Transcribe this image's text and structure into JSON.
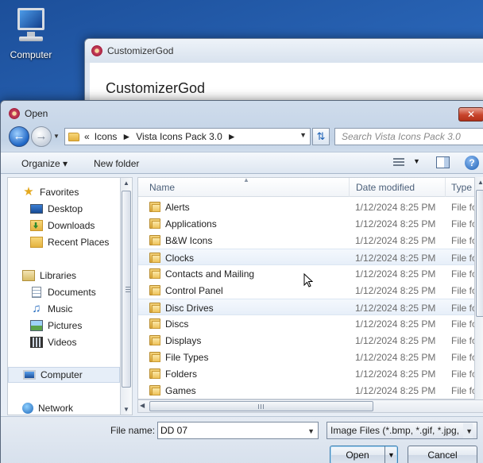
{
  "desktop": {
    "computer_label": "Computer"
  },
  "bg_window": {
    "title": "CustomizerGod",
    "heading": "CustomizerGod"
  },
  "dialog": {
    "title": "Open",
    "close_glyph": "✕",
    "breadcrumb": [
      "Icons",
      "Vista Icons Pack 3.0"
    ],
    "breadcrumb_prefix": "«",
    "search_placeholder": "Search Vista Icons Pack 3.0",
    "toolbar": {
      "organize": "Organize ▾",
      "new_folder": "New folder"
    },
    "nav": {
      "favorites": "Favorites",
      "desktop": "Desktop",
      "downloads": "Downloads",
      "recent_places": "Recent Places",
      "libraries": "Libraries",
      "documents": "Documents",
      "music": "Music",
      "pictures": "Pictures",
      "videos": "Videos",
      "computer": "Computer",
      "network": "Network"
    },
    "columns": {
      "name": "Name",
      "date": "Date modified",
      "type": "Type"
    },
    "files": [
      {
        "name": "Alerts",
        "date": "1/12/2024 8:25 PM",
        "type": "File fol"
      },
      {
        "name": "Applications",
        "date": "1/12/2024 8:25 PM",
        "type": "File fol"
      },
      {
        "name": "B&W Icons",
        "date": "1/12/2024 8:25 PM",
        "type": "File fol"
      },
      {
        "name": "Clocks",
        "date": "1/12/2024 8:25 PM",
        "type": "File fol"
      },
      {
        "name": "Contacts and Mailing",
        "date": "1/12/2024 8:25 PM",
        "type": "File fol"
      },
      {
        "name": "Control Panel",
        "date": "1/12/2024 8:25 PM",
        "type": "File fol"
      },
      {
        "name": "Disc Drives",
        "date": "1/12/2024 8:25 PM",
        "type": "File fol"
      },
      {
        "name": "Discs",
        "date": "1/12/2024 8:25 PM",
        "type": "File fol"
      },
      {
        "name": "Displays",
        "date": "1/12/2024 8:25 PM",
        "type": "File fol"
      },
      {
        "name": "File Types",
        "date": "1/12/2024 8:25 PM",
        "type": "File fol"
      },
      {
        "name": "Folders",
        "date": "1/12/2024 8:25 PM",
        "type": "File fol"
      },
      {
        "name": "Games",
        "date": "1/12/2024 8:25 PM",
        "type": "File fol"
      }
    ],
    "file_name_label": "File name:",
    "file_name_value": "DD 07",
    "file_type_value": "Image Files (*.bmp, *.gif, *.jpg, ",
    "open_button": "Open",
    "cancel_button": "Cancel"
  }
}
